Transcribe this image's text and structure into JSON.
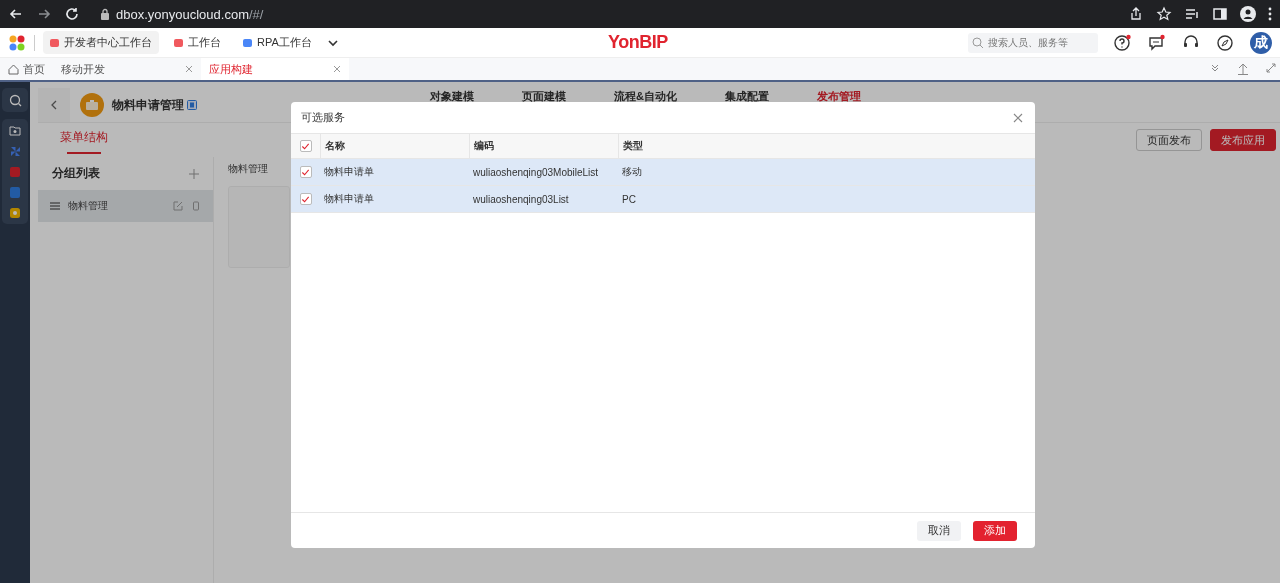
{
  "browser": {
    "url_host": "dbox.yonyoucloud.com",
    "url_path": "/#/"
  },
  "header": {
    "apps": [
      {
        "label": "开发者中心工作台",
        "selected": true,
        "color": "#f0595e"
      },
      {
        "label": "工作台",
        "selected": false,
        "color": "#f0595e"
      },
      {
        "label": "RPA工作台",
        "selected": false,
        "color": "#4a86f7"
      }
    ],
    "logo": "YonBIP",
    "search": {
      "placeholder": "搜索人员、服务等"
    },
    "avatar": "成"
  },
  "tabs": [
    {
      "kind": "home",
      "label": "首页",
      "selected": false
    },
    {
      "kind": "tab",
      "label": "移动开发",
      "selected": false
    },
    {
      "kind": "tab",
      "label": "应用构建",
      "selected": true
    }
  ],
  "app": {
    "title": "物料申请管理",
    "nav": [
      {
        "label": "对象建模",
        "selected": false
      },
      {
        "label": "页面建模",
        "selected": false
      },
      {
        "label": "流程&自动化",
        "selected": false
      },
      {
        "label": "集成配置",
        "selected": false
      },
      {
        "label": "发布管理",
        "selected": true
      }
    ],
    "subtab": {
      "label": "菜单结构",
      "selected": true
    },
    "actions": [
      {
        "label": "页面发布",
        "kind": "secondary"
      },
      {
        "label": "发布应用",
        "kind": "primary"
      }
    ],
    "group_list": {
      "title": "分组列表",
      "items": [
        {
          "label": "物料管理",
          "selected": true
        }
      ]
    },
    "breadcrumb": "物料管理"
  },
  "dialog": {
    "title": "可选服务",
    "select_all": {
      "checked": true
    },
    "columns": [
      "名称",
      "编码",
      "类型"
    ],
    "rows": [
      {
        "cells": [
          "物料申请单",
          "wuliaoshenqing03MobileList",
          "移动"
        ],
        "checked": true
      },
      {
        "cells": [
          "物料申请单",
          "wuliaoshenqing03List",
          "PC"
        ],
        "checked": true
      }
    ],
    "buttons": [
      {
        "label": "取消",
        "kind": "secondary"
      },
      {
        "label": "添加",
        "kind": "primary"
      }
    ]
  }
}
